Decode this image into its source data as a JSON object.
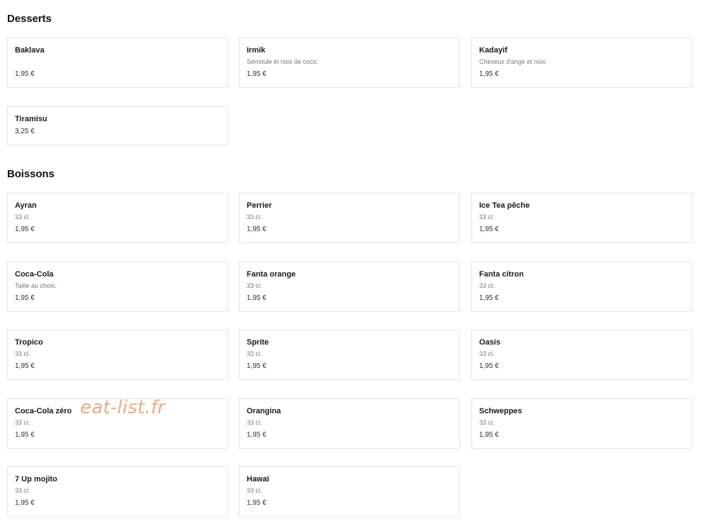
{
  "desserts": {
    "title": "Desserts",
    "items": [
      {
        "name": "Baklava",
        "desc": "",
        "price": "1,95 €"
      },
      {
        "name": "Irmik",
        "desc": "Semoule et noix de coco.",
        "price": "1,95 €"
      },
      {
        "name": "Kadayif",
        "desc": "Cheveux d'ange et noix.",
        "price": "1,95 €"
      },
      {
        "name": "Tiramisu",
        "desc": "",
        "price": "3,25 €"
      }
    ]
  },
  "boissons": {
    "title": "Boissons",
    "items": [
      {
        "name": "Ayran",
        "desc": "33 cl.",
        "price": "1,95 €"
      },
      {
        "name": "Perrier",
        "desc": "33 cl.",
        "price": "1,95 €"
      },
      {
        "name": "Ice Tea pêche",
        "desc": "33 cl.",
        "price": "1,95 €"
      },
      {
        "name": "Coca-Cola",
        "desc": "Taille au choix.",
        "price": "1,95 €"
      },
      {
        "name": "Fanta orange",
        "desc": "33 cl.",
        "price": "1,95 €"
      },
      {
        "name": "Fanta citron",
        "desc": "33 cl.",
        "price": "1,95 €"
      },
      {
        "name": "Tropico",
        "desc": "33 cl.",
        "price": "1,95 €"
      },
      {
        "name": "Sprite",
        "desc": "33 cl.",
        "price": "1,95 €"
      },
      {
        "name": "Oasis",
        "desc": "33 cl.",
        "price": "1,95 €"
      },
      {
        "name": "Coca-Cola zéro",
        "desc": "33 cl.",
        "price": "1,95 €"
      },
      {
        "name": "Orangina",
        "desc": "33 cl.",
        "price": "1,95 €"
      },
      {
        "name": "Schweppes",
        "desc": "33 cl.",
        "price": "1,95 €"
      },
      {
        "name": "7 Up mojito",
        "desc": "33 cl.",
        "price": "1,95 €"
      },
      {
        "name": "Hawaï",
        "desc": "33 cl.",
        "price": "1,95 €"
      }
    ]
  },
  "watermark": "eat-list.fr"
}
